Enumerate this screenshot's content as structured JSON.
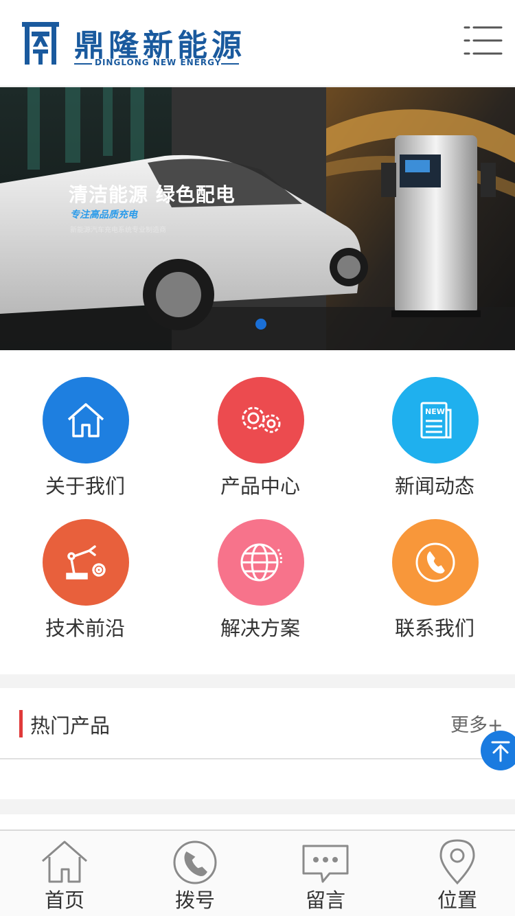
{
  "header": {
    "brand_cn": "鼎隆新能源",
    "brand_en": "DINGLONG NEW ENERGY",
    "menu_icon": "menu-icon",
    "brand_color": "#1a5a9e"
  },
  "banner": {
    "headline": "清洁能源  绿色配电",
    "subheadline": "专注高品质充电",
    "description": "新能源汽车充电系统专业制造商",
    "active_slide": 1,
    "slide_count": 1
  },
  "grid": {
    "items": [
      {
        "label": "关于我们",
        "icon": "home-icon",
        "color": "#1e7fe0"
      },
      {
        "label": "产品中心",
        "icon": "gears-icon",
        "color": "#ec4b4f"
      },
      {
        "label": "新闻动态",
        "icon": "newspaper-icon",
        "color": "#1fb0ee"
      },
      {
        "label": "技术前沿",
        "icon": "robot-arm-icon",
        "color": "#e8603c"
      },
      {
        "label": "解决方案",
        "icon": "globe-icon",
        "color": "#f7738b"
      },
      {
        "label": "联系我们",
        "icon": "phone-icon",
        "color": "#f8973a"
      }
    ]
  },
  "hot_products": {
    "title": "热门产品",
    "more": "更多+",
    "accent": "#e03a3a"
  },
  "back_to_top": {
    "icon": "arrow-up-icon",
    "color": "#1a7be0"
  },
  "bottom_nav": {
    "items": [
      {
        "label": "首页",
        "icon": "home-outline-icon"
      },
      {
        "label": "拨号",
        "icon": "phone-outline-icon"
      },
      {
        "label": "留言",
        "icon": "message-icon"
      },
      {
        "label": "位置",
        "icon": "location-pin-icon"
      }
    ]
  }
}
